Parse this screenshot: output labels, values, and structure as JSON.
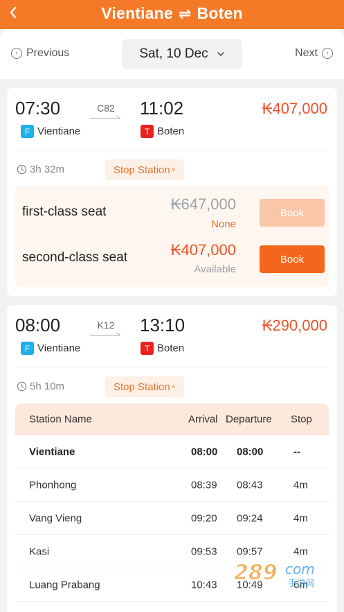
{
  "header": {
    "from": "Vientiane",
    "swap_symbol": "⇌",
    "to": "Boten",
    "background": "#f47a28"
  },
  "date_nav": {
    "previous_label": "Previous",
    "date_label": "Sat, 10 Dec",
    "next_label": "Next"
  },
  "trains": [
    {
      "depart_time": "07:30",
      "code": "C82",
      "arrive_time": "11:02",
      "price": "₭407,000",
      "from_badge": "F",
      "from_station": "Vientiane",
      "to_badge": "T",
      "to_station": "Boten",
      "duration": "3h 32m",
      "stop_station_label": "Stop Station",
      "stop_station_chevron": "˅",
      "seats": [
        {
          "name": "first-class seat",
          "price": "₭647,000",
          "availability": "None",
          "book_label": "Book",
          "enabled": false,
          "price_color": "#9aa3ad",
          "avail_color": "#e8742a"
        },
        {
          "name": "second-class seat",
          "price": "₭407,000",
          "availability": "Available",
          "book_label": "Book",
          "enabled": true,
          "price_color": "#e8542a",
          "avail_color": "#9aa3ad"
        }
      ]
    },
    {
      "depart_time": "08:00",
      "code": "K12",
      "arrive_time": "13:10",
      "price": "₭290,000",
      "from_badge": "F",
      "from_station": "Vientiane",
      "to_badge": "T",
      "to_station": "Boten",
      "duration": "5h 10m",
      "stop_station_label": "Stop Station",
      "stop_station_chevron": "˄",
      "stops_table": {
        "headers": {
          "name": "Station Name",
          "arrival": "Arrival",
          "departure": "Departure",
          "stop": "Stop"
        },
        "rows": [
          {
            "name": "Vientiane",
            "arrival": "08:00",
            "departure": "08:00",
            "stop": "--"
          },
          {
            "name": "Phonhong",
            "arrival": "08:39",
            "departure": "08:43",
            "stop": "4m"
          },
          {
            "name": "Vang Vieng",
            "arrival": "09:20",
            "departure": "09:24",
            "stop": "4m"
          },
          {
            "name": "Kasi",
            "arrival": "09:53",
            "departure": "09:57",
            "stop": "4m"
          },
          {
            "name": "Luang Prabang",
            "arrival": "10:43",
            "departure": "10:49",
            "stop": "6m"
          }
        ]
      }
    }
  ],
  "watermark": {
    "text_main": "289",
    "text_suffix": "com",
    "text_sub": "手游网"
  },
  "colors": {
    "accent": "#f47a28",
    "price": "#e8542a",
    "badge_from": "#1fb0ea",
    "badge_to": "#e8231f"
  }
}
